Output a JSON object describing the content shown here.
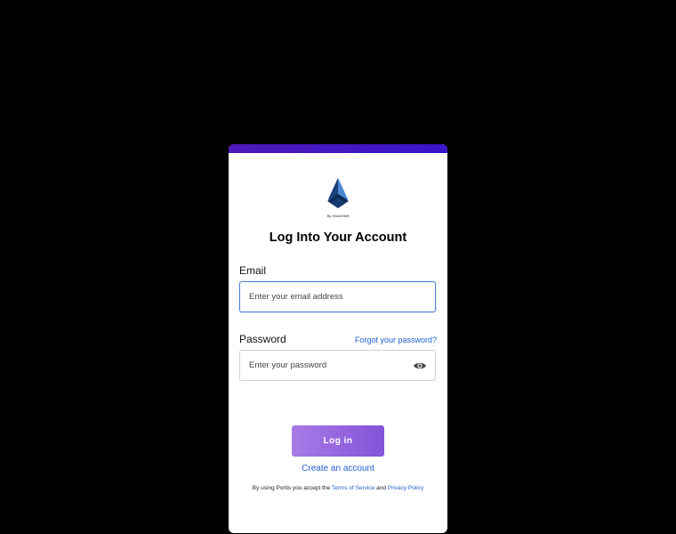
{
  "logo": {
    "caption": "By ShareShift",
    "icon": "droplet-logo-icon",
    "colors": {
      "dark": "#0e2a52",
      "mid": "#2a5aa0",
      "light": "#4d8ad6"
    }
  },
  "title": "Log Into Your Account",
  "email": {
    "label": "Email",
    "placeholder": "Enter your email address",
    "value": ""
  },
  "password": {
    "label": "Password",
    "placeholder": "Enter your password",
    "value": "",
    "forgot_label": "Forgot your password?",
    "toggle_icon": "eye-icon"
  },
  "login_button": {
    "label": "Log in"
  },
  "create_account_label": "Create an account",
  "terms": {
    "prefix": "By using Portis you accept the",
    "tos": "Terms of Service",
    "and": "and",
    "privacy": "Privacy Policy"
  },
  "colors": {
    "background": "#000000",
    "top_bar": "#4d1ab8",
    "button": "#9a6ae2",
    "link": "#1f5fd0",
    "focus_border": "#4a7fd8"
  }
}
